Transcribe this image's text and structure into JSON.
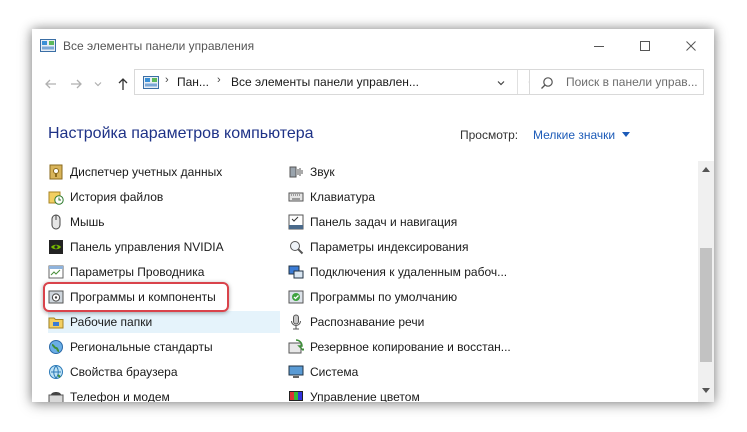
{
  "window": {
    "title": "Все элементы панели управления",
    "controls": [
      "minimize-icon",
      "maximize-icon",
      "close-icon"
    ]
  },
  "navigation": {
    "back_icon": "arrow-left-icon",
    "forward_icon": "arrow-right-icon",
    "up_icon": "arrow-up-icon",
    "breadcrumb": [
      "Пан...",
      "Все элементы панели управлен..."
    ],
    "refresh_icon": "refresh-icon"
  },
  "search": {
    "placeholder": "Поиск в панели управ...",
    "value": ""
  },
  "header": {
    "title": "Настройка параметров компьютера",
    "view_label": "Просмотр:",
    "view_value": "Мелкие значки"
  },
  "items_left": [
    {
      "label": "Диспетчер учетных данных",
      "icon": "credential-manager-icon"
    },
    {
      "label": "История файлов",
      "icon": "file-history-icon"
    },
    {
      "label": "Мышь",
      "icon": "mouse-icon"
    },
    {
      "label": "Панель управления NVIDIA",
      "icon": "nvidia-icon"
    },
    {
      "label": "Параметры Проводника",
      "icon": "explorer-options-icon"
    },
    {
      "label": "Программы и компоненты",
      "icon": "programs-features-icon"
    },
    {
      "label": "Рабочие папки",
      "icon": "work-folders-icon"
    },
    {
      "label": "Региональные стандарты",
      "icon": "region-icon"
    },
    {
      "label": "Свойства браузера",
      "icon": "internet-options-icon"
    },
    {
      "label": "Телефон и модем",
      "icon": "phone-modem-icon"
    }
  ],
  "items_right": [
    {
      "label": "Звук",
      "icon": "sound-icon"
    },
    {
      "label": "Клавиатура",
      "icon": "keyboard-icon"
    },
    {
      "label": "Панель задач и навигация",
      "icon": "taskbar-icon"
    },
    {
      "label": "Параметры индексирования",
      "icon": "indexing-icon"
    },
    {
      "label": "Подключения к удаленным рабоч...",
      "icon": "remote-desktop-icon"
    },
    {
      "label": "Программы по умолчанию",
      "icon": "default-programs-icon"
    },
    {
      "label": "Распознавание речи",
      "icon": "speech-icon"
    },
    {
      "label": "Резервное копирование и восстан...",
      "icon": "backup-icon"
    },
    {
      "label": "Система",
      "icon": "system-icon"
    },
    {
      "label": "Управление цветом",
      "icon": "color-management-icon"
    }
  ],
  "annotation": {
    "highlighted_item": "Программы и компоненты",
    "ring_color": "#d9434b"
  },
  "colors": {
    "title": "#1e3287",
    "link": "#1c5bb8",
    "hover_bg": "#e5f3fb"
  }
}
